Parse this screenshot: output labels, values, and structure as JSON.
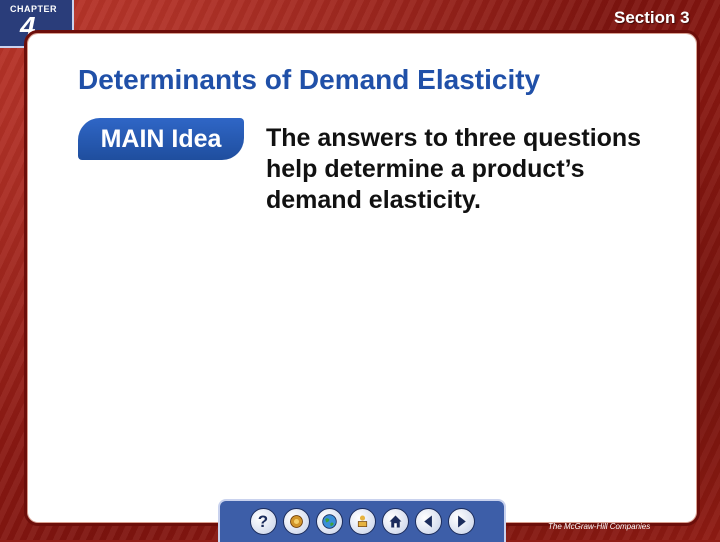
{
  "header": {
    "chapter_label": "CHAPTER",
    "chapter_number": "4",
    "section_label": "Section 3"
  },
  "slide": {
    "title": "Determinants of Demand Elasticity",
    "main_idea_label": "MAIN Idea",
    "main_idea_text": "The answers to three questions help determine a product’s demand elasticity."
  },
  "nav": {
    "buttons": [
      "help-icon",
      "resources-icon",
      "globe-icon",
      "reading-icon",
      "home-icon",
      "back-icon",
      "forward-icon"
    ],
    "help_glyph": "?"
  },
  "footer": {
    "publisher": "The McGraw-Hill Companies"
  },
  "colors": {
    "background": "#8f1b14",
    "title": "#2050a8",
    "main_idea_badge": "#2f66c6",
    "nav_bar": "#3d5ea8",
    "chapter_tab": "#2a3d7a"
  }
}
